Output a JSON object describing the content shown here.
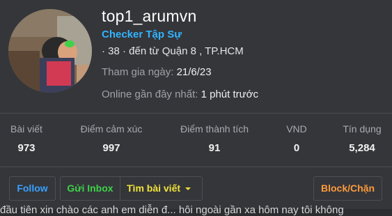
{
  "profile": {
    "username": "top1_arumvn",
    "role": "Checker Tập Sự",
    "meta": "· 38 · đến từ Quận 8 , TP.HCM",
    "joined_label": "Tham gia ngày:",
    "joined_value": "21/6/23",
    "online_label": "Online gần đây nhất:",
    "online_value": "1 phút trước"
  },
  "stats": [
    {
      "label": "Bài viết",
      "value": "973"
    },
    {
      "label": "Điểm cảm xúc",
      "value": "997"
    },
    {
      "label": "Điểm thành tích",
      "value": "91"
    },
    {
      "label": "VND",
      "value": "0"
    },
    {
      "label": "Tín dụng",
      "value": "5,284"
    }
  ],
  "actions": {
    "follow": "Follow",
    "inbox": "Gửi Inbox",
    "find_posts": "Tìm bài viết",
    "block": "Block/Chặn"
  },
  "colors": {
    "role": "#33b4ff",
    "follow": "#3aa0ff",
    "inbox": "#3fd24a",
    "find_posts": "#f2e23a",
    "block": "#ff9a3c"
  },
  "below_text": "đầu tiên xin chào các anh em diễn đ... hôi ngoài gần xa hôm nay tôi không"
}
